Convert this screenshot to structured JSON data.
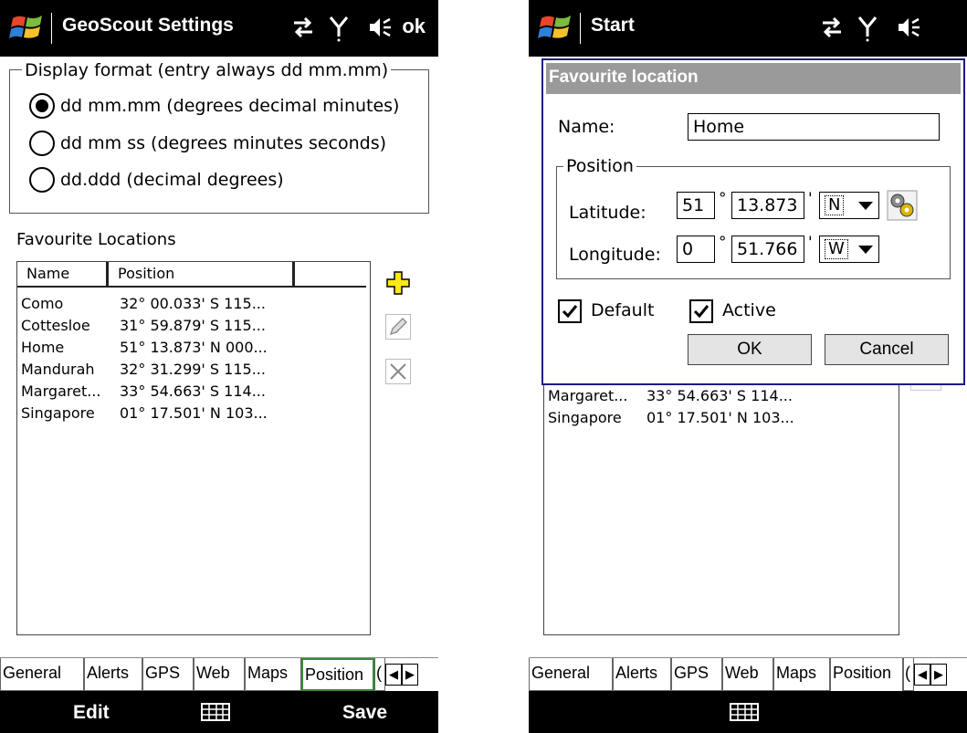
{
  "left": {
    "title": "GeoScout Settings",
    "ok": "ok",
    "display_format": {
      "legend": "Display format (entry always dd mm.mm)",
      "options": [
        {
          "label": "dd mm.mm (degrees decimal minutes)",
          "selected": true
        },
        {
          "label": "dd mm ss (degrees minutes seconds)",
          "selected": false
        },
        {
          "label": "dd.ddd (decimal degrees)",
          "selected": false
        }
      ]
    },
    "favourites_label": "Favourite Locations",
    "columns": [
      "Name",
      "Position"
    ],
    "rows": [
      {
        "name": "Como",
        "position": "32° 00.033' S  115..."
      },
      {
        "name": "Cottesloe",
        "position": "31° 59.879' S  115..."
      },
      {
        "name": "Home",
        "position": "51° 13.873' N  000..."
      },
      {
        "name": "Mandurah",
        "position": "32° 31.299' S  115..."
      },
      {
        "name": "Margaret...",
        "position": "33° 54.663' S  114..."
      },
      {
        "name": "Singapore",
        "position": "01° 17.501' N  103..."
      }
    ],
    "tabs": [
      "General",
      "Alerts",
      "GPS",
      "Web",
      "Maps",
      "Position",
      "("
    ],
    "softkeys": {
      "left": "Edit",
      "right": "Save"
    }
  },
  "right": {
    "title": "Start",
    "dialog": {
      "title": "Favourite location",
      "name_label": "Name:",
      "name_value": "Home",
      "position_legend": "Position",
      "latitude_label": "Latitude:",
      "lat_deg": "51",
      "lat_min": "13.873",
      "lat_hemi": "N",
      "longitude_label": "Longitude:",
      "lon_deg": "0",
      "lon_min": "51.766",
      "lon_hemi": "W",
      "deg_symbol": "°",
      "min_symbol": "'",
      "default_label": "Default",
      "active_label": "Active",
      "ok_label": "OK",
      "cancel_label": "Cancel"
    },
    "rows": [
      {
        "name": "Margaret...",
        "position": "33° 54.663' S  114..."
      },
      {
        "name": "Singapore",
        "position": "01° 17.501' N  103..."
      }
    ],
    "tabs": [
      "General",
      "Alerts",
      "GPS",
      "Web",
      "Maps",
      "Position",
      "("
    ]
  },
  "colors": {
    "titlebar": "#000000",
    "dialog_border": "#1a1a8c",
    "dialog_title": "#9a9a9a",
    "focus_tab": "#3a8a3a"
  }
}
